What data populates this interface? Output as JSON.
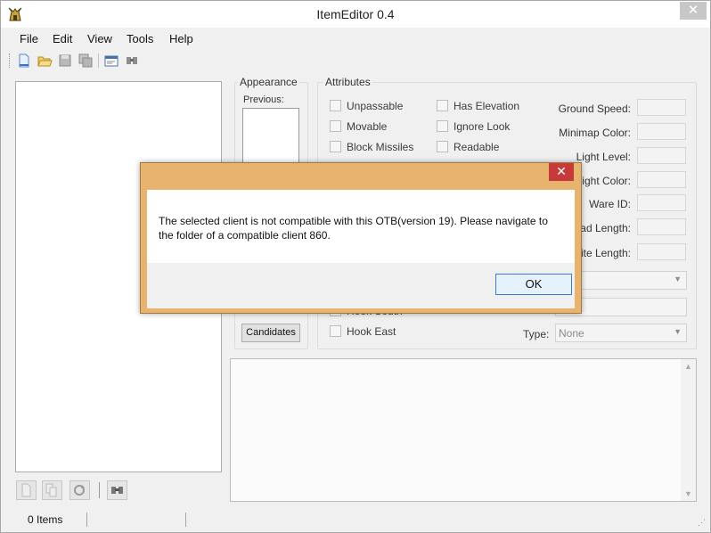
{
  "window": {
    "title": "ItemEditor 0.4",
    "close_glyph": "✕"
  },
  "menu": [
    "File",
    "Edit",
    "View",
    "Tools",
    "Help"
  ],
  "toolbar_icons": [
    "new-file-icon",
    "open-folder-icon",
    "save-icon",
    "save-all-icon",
    "item-view-icon",
    "find-item-icon"
  ],
  "appearance": {
    "legend": "Appearance",
    "previous_label": "Previous:",
    "candidates_label": "Candidates"
  },
  "attributes": {
    "legend": "Attributes",
    "checkboxes_col1": [
      "Unpassable",
      "Movable",
      "Block Missiles"
    ],
    "checkboxes_col2": [
      "Has Elevation",
      "Ignore Look",
      "Readable"
    ],
    "hook_south": "Hook South",
    "hook_east": "Hook East",
    "fields": {
      "ground_speed": "Ground Speed:",
      "minimap_color": "Minimap Color:",
      "light_level": "Light Level:",
      "light_color": "Light Color:",
      "ware_id": "Ware ID:",
      "read_length": "ead Length:",
      "write_length": "Vrite Length:"
    },
    "type_label": "Type:",
    "type_value": "None"
  },
  "status": {
    "items_count": "0 Items"
  },
  "dialog": {
    "close_glyph": "✕",
    "message": "The selected client is not compatible with this OTB(version 19). Please navigate to the folder of a compatible client 860.",
    "ok_label": "OK"
  },
  "colors": {
    "dialog_frame": "#e8b36f",
    "dialog_close": "#c73a3a",
    "ok_border": "#3d7bd4"
  }
}
